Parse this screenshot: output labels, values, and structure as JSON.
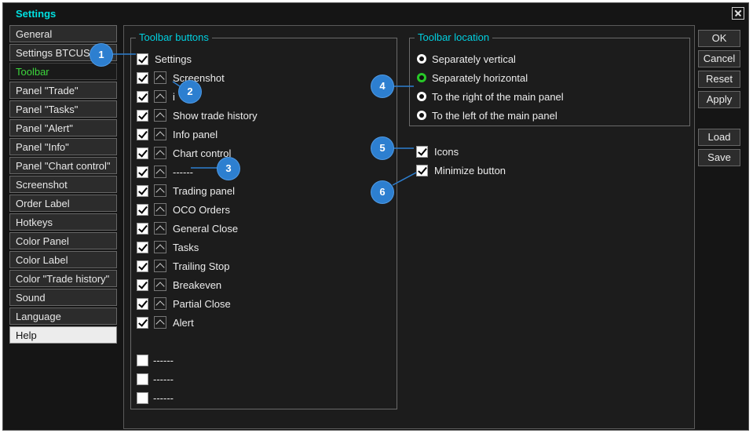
{
  "window": {
    "title": "Settings"
  },
  "tabs": [
    {
      "label": "General"
    },
    {
      "label": "Settings BTCUSD"
    },
    {
      "label": "Toolbar"
    },
    {
      "label": "Panel \"Trade\""
    },
    {
      "label": "Panel \"Tasks\""
    },
    {
      "label": "Panel \"Alert\""
    },
    {
      "label": "Panel \"Info\""
    },
    {
      "label": "Panel \"Chart control\""
    },
    {
      "label": "Screenshot"
    },
    {
      "label": "Order Label"
    },
    {
      "label": "Hotkeys"
    },
    {
      "label": "Color Panel"
    },
    {
      "label": "Color Label"
    },
    {
      "label": "Color \"Trade history\""
    },
    {
      "label": "Sound"
    },
    {
      "label": "Language"
    },
    {
      "label": "Help"
    }
  ],
  "active_tab": "Toolbar",
  "toolbar_buttons": {
    "title": "Toolbar buttons",
    "settings_label": "Settings",
    "items": [
      {
        "label": "Screenshot"
      },
      {
        "label": "i"
      },
      {
        "label": "Show trade history"
      },
      {
        "label": "Info panel"
      },
      {
        "label": "Chart control"
      },
      {
        "label": "------"
      },
      {
        "label": "Trading panel"
      },
      {
        "label": "OCO Orders"
      },
      {
        "label": "General Close"
      },
      {
        "label": "Tasks"
      },
      {
        "label": "Trailing Stop"
      },
      {
        "label": "Breakeven"
      },
      {
        "label": "Partial Close"
      },
      {
        "label": "Alert"
      }
    ],
    "extra": [
      {
        "label": "------"
      },
      {
        "label": "------"
      },
      {
        "label": "------"
      }
    ]
  },
  "toolbar_location": {
    "title": "Toolbar location",
    "options": [
      {
        "label": "Separately vertical"
      },
      {
        "label": "Separately horizontal"
      },
      {
        "label": "To the right of the main panel"
      },
      {
        "label": "To the left of the main panel"
      }
    ],
    "selected": "Separately horizontal"
  },
  "options": {
    "icons_label": "Icons",
    "minimize_label": "Minimize button"
  },
  "buttons": {
    "ok": "OK",
    "cancel": "Cancel",
    "reset": "Reset",
    "apply": "Apply",
    "load": "Load",
    "save": "Save"
  },
  "badges": [
    "1",
    "2",
    "3",
    "4",
    "5",
    "6"
  ],
  "colors": {
    "title": "#00e0e0",
    "active_tab": "#3cd63c",
    "group_title": "#00d0e0",
    "badge": "#2d7fd0",
    "radio_selected": "#28c828"
  }
}
